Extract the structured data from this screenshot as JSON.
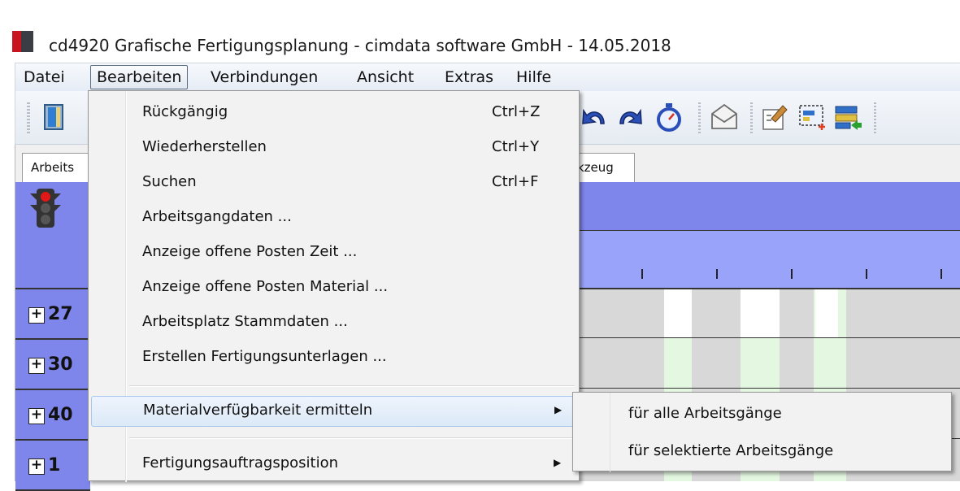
{
  "window": {
    "title": "cd4920 Grafische Fertigungsplanung - cimdata software GmbH - 14.05.2018"
  },
  "menubar": [
    {
      "label": "Datei"
    },
    {
      "label": "Bearbeiten",
      "active": true
    },
    {
      "label": "Verbindungen"
    },
    {
      "label": "Ansicht"
    },
    {
      "label": "Extras"
    },
    {
      "label": "Hilfe"
    }
  ],
  "toolbar": {
    "icons": [
      "exit-door-icon",
      "undo-icon",
      "redo-icon",
      "stopwatch-icon",
      "envelope-icon",
      "properties-icon",
      "select-area-icon",
      "transfer-icon"
    ]
  },
  "tabs": {
    "left_partial": "Arbeits",
    "right_partial": "kzeug"
  },
  "left_rows": [
    {
      "label": "27"
    },
    {
      "label": "30"
    },
    {
      "label": "40"
    },
    {
      "label": "1"
    }
  ],
  "edit_menu": {
    "items": [
      {
        "label": "Rückgängig",
        "shortcut": "Ctrl+Z"
      },
      {
        "label": "Wiederherstellen",
        "shortcut": "Ctrl+Y"
      },
      {
        "label": "Suchen",
        "shortcut": "Ctrl+F"
      },
      {
        "label": "Arbeitsgangdaten ..."
      },
      {
        "label": "Anzeige offene Posten Zeit ..."
      },
      {
        "label": "Anzeige offene Posten Material ..."
      },
      {
        "label": "Arbeitsplatz Stammdaten ..."
      },
      {
        "label": "Erstellen Fertigungsunterlagen ..."
      },
      {
        "label": "Materialverfügbarkeit ermitteln",
        "submenu": true,
        "highlighted": true
      },
      {
        "label": "Fertigungsauftragsposition",
        "submenu": true
      }
    ]
  },
  "submenu": {
    "items": [
      {
        "label": "für alle Arbeitsgänge"
      },
      {
        "label": "für selektierte Arbeitsgänge"
      }
    ]
  },
  "colors": {
    "lane_blue": "#7e86ec",
    "header_light_blue": "#9aa3fa",
    "highlight": "#dce9f8",
    "brand_red": "#c8141e"
  }
}
